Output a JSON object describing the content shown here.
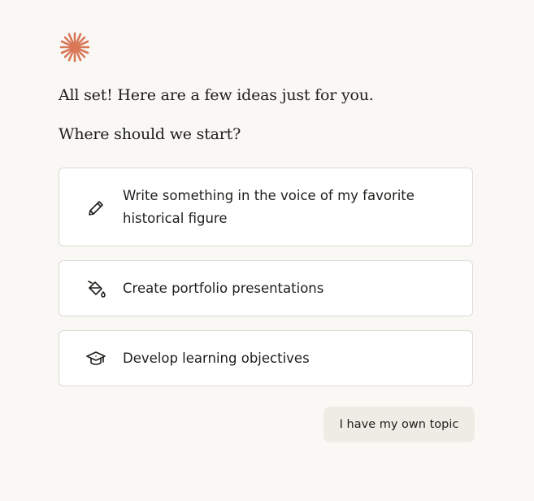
{
  "brand": {
    "logo_icon": "sparkle-asterisk-icon",
    "accent_color": "#d97757"
  },
  "intro": {
    "message": "All set! Here are a few ideas just for you.",
    "question": "Where should we start?"
  },
  "suggestions": [
    {
      "icon": "pencil-icon",
      "label": "Write something in the voice of my favorite historical figure"
    },
    {
      "icon": "paint-bucket-icon",
      "label": "Create portfolio presentations"
    },
    {
      "icon": "graduation-cap-icon",
      "label": "Develop learning objectives"
    }
  ],
  "actions": {
    "own_topic_label": "I have my own topic"
  }
}
